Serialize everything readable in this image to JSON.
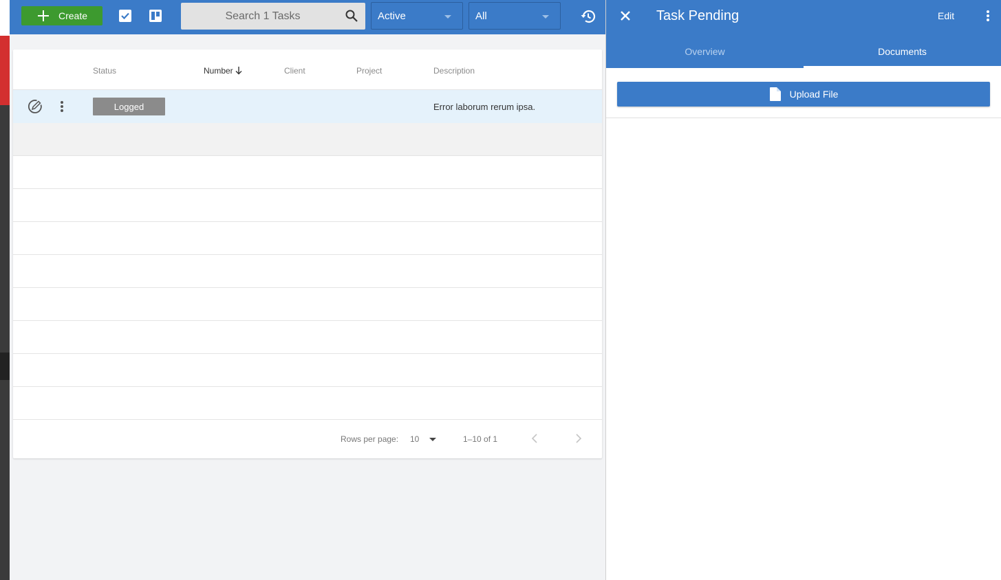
{
  "toolbar": {
    "create_label": "Create",
    "search_placeholder": "Search 1 Tasks",
    "status_filter": "Active",
    "scope_filter": "All"
  },
  "table": {
    "columns": [
      "Status",
      "Number",
      "Client",
      "Project",
      "Description"
    ],
    "sorted_column": "Number",
    "rows": [
      {
        "status": "Logged",
        "number": "",
        "client": "",
        "project": "",
        "description": "Error laborum rerum ipsa."
      }
    ]
  },
  "pagination": {
    "rows_per_page_label": "Rows per page:",
    "rows_per_page_value": "10",
    "range_text": "1–10 of 1"
  },
  "panel": {
    "title": "Task Pending",
    "edit_label": "Edit",
    "tabs": [
      {
        "label": "Overview",
        "active": false
      },
      {
        "label": "Documents",
        "active": true
      }
    ],
    "upload_label": "Upload File"
  },
  "colors": {
    "brand_blue": "#3b7bc8",
    "create_green": "#3d9a2f",
    "status_logged": "#8b8b8b",
    "selected_row": "#e5f2fb"
  },
  "icons": [
    "plus-icon",
    "checkbox-icon",
    "kanban-icon",
    "search-icon",
    "history-icon",
    "edit-circle-icon",
    "more-vert-icon",
    "sort-down-icon",
    "chevron-left-icon",
    "chevron-right-icon",
    "close-icon",
    "file-icon"
  ]
}
